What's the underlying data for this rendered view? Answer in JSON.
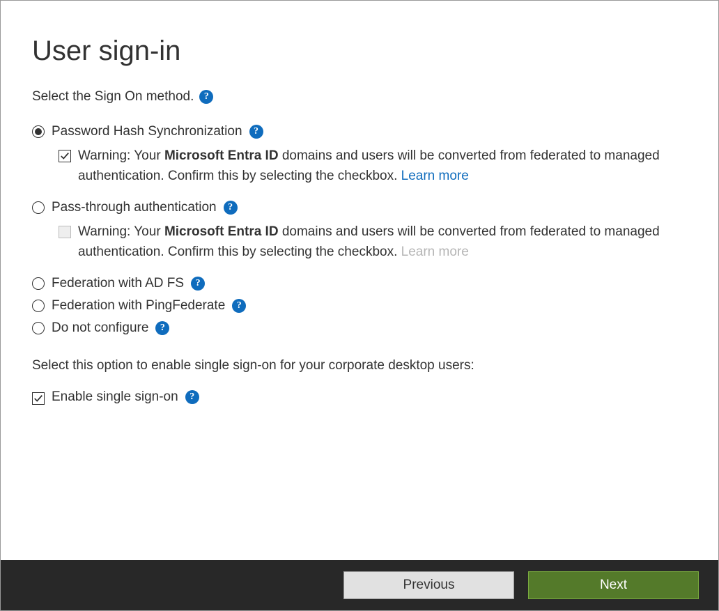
{
  "page": {
    "title": "User sign-in",
    "selectMethodLabel": "Select the Sign On method."
  },
  "options": {
    "phs": {
      "label": "Password Hash Synchronization",
      "warningPrefix": "Warning: Your ",
      "warningBold": "Microsoft Entra ID",
      "warningRest": " domains and users will be converted from federated to managed authentication. Confirm this by selecting the checkbox. ",
      "learnMore": "Learn more"
    },
    "pta": {
      "label": "Pass-through authentication",
      "warningPrefix": "Warning: Your ",
      "warningBold": "Microsoft Entra ID",
      "warningRest": " domains and users will be converted from federated to managed authentication. Confirm this by selecting the checkbox. ",
      "learnMore": "Learn more"
    },
    "adfs": {
      "label": "Federation with AD FS"
    },
    "ping": {
      "label": "Federation with PingFederate"
    },
    "none": {
      "label": "Do not configure"
    }
  },
  "sso": {
    "sectionText": "Select this option to enable single sign-on for your corporate desktop users:",
    "label": "Enable single sign-on"
  },
  "buttons": {
    "previous": "Previous",
    "next": "Next"
  },
  "state": {
    "selectedOption": "phs",
    "phsConfirmChecked": true,
    "ptaConfirmChecked": false,
    "ssoChecked": true
  }
}
